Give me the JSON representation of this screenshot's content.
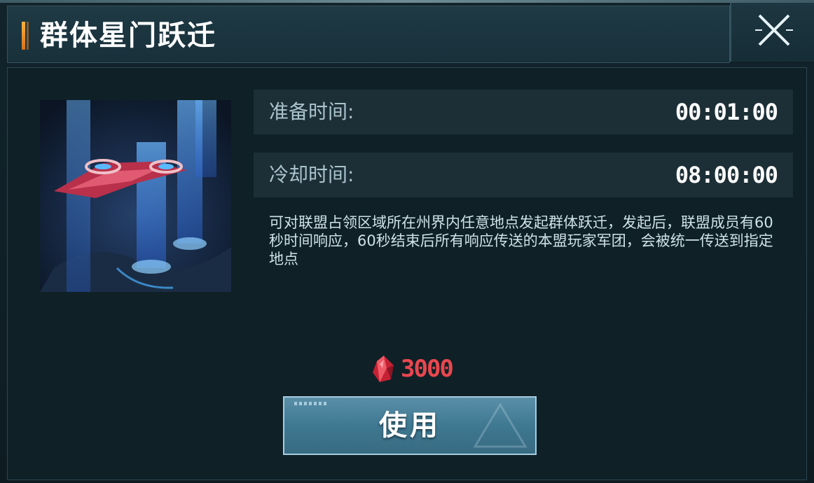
{
  "dialog": {
    "title": "群体星门跃迁"
  },
  "info": {
    "prepare_label": "准备时间:",
    "prepare_value": "00:01:00",
    "cooldown_label": "冷却时间:",
    "cooldown_value": "08:00:00",
    "description": "可对联盟占领区域所在州界内任意地点发起群体跃迁，发起后，联盟成员有60秒时间响应，60秒结束后所有响应传送的本盟玩家军团，会被统一传送到指定地点"
  },
  "cost": {
    "icon": "red-crystal-icon",
    "value": "3000",
    "color": "#e8474f"
  },
  "actions": {
    "use_label": "使用"
  },
  "colors": {
    "accent": "#ffb23a",
    "button": "#4a85a0",
    "panel": "#0f2027"
  }
}
